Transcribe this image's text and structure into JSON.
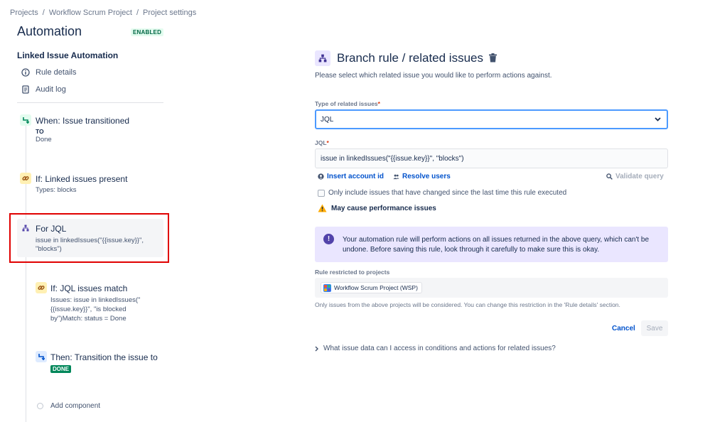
{
  "breadcrumb": {
    "items": [
      "Projects",
      "Workflow Scrum Project",
      "Project settings"
    ],
    "separator": "/"
  },
  "page": {
    "title": "Automation",
    "status_badge": "ENABLED"
  },
  "sidebar": {
    "rule_name": "Linked Issue Automation",
    "links": [
      {
        "label": "Rule details",
        "icon": "info-icon"
      },
      {
        "label": "Audit log",
        "icon": "document-icon"
      }
    ],
    "components": [
      {
        "title": "When: Issue transitioned",
        "lines": [
          "TO",
          "Done"
        ],
        "icon": "transition-icon",
        "color": "#e3fcef"
      },
      {
        "title": "If: Linked issues present",
        "lines": [
          "Types: blocks"
        ],
        "icon": "link-icon",
        "color": "#fff0b3"
      },
      {
        "title": "For JQL",
        "lines": [
          "issue in linkedIssues(\"{{issue.key}}\",",
          "\"blocks\")"
        ],
        "icon": "branch-icon",
        "color": "#eae6ff"
      },
      {
        "title": "If: JQL issues match",
        "lines": [
          "Issues: issue in linkedIssues(\"",
          "{{issue.key}}\", \"is blocked",
          "by\")Match: status = Done"
        ],
        "icon": "link-icon",
        "color": "#fff0b3"
      },
      {
        "title": "Then: Transition the issue to",
        "lozenge": "DONE",
        "icon": "transition-icon",
        "color": "#deebff"
      }
    ],
    "add_component": "Add component"
  },
  "main": {
    "title": "Branch rule / related issues",
    "description": "Please select which related issue you would like to perform actions against.",
    "type_label": "Type of related issues",
    "type_value": "JQL",
    "jql_label": "JQL",
    "jql_value": "issue in linkedIssues(\"{{issue.key}}\", \"blocks\")",
    "insert_account_id": "Insert account id",
    "resolve_users": "Resolve users",
    "validate_query": "Validate query",
    "checkbox_label": "Only include issues that have changed since the last time this rule executed",
    "warning": "May cause performance issues",
    "info_text": "Your automation rule will perform actions on all issues returned in the above query, which can't be undone. Before saving this rule, look through it carefully to make sure this is okay.",
    "restricted_label": "Rule restricted to projects",
    "project_tag": "Workflow Scrum Project (WSP)",
    "restriction_help": "Only issues from the above projects will be considered. You can change this restriction in the 'Rule details' section.",
    "cancel_label": "Cancel",
    "save_label": "Save",
    "expander_label": "What issue data can I access in conditions and actions for related issues?"
  },
  "colors": {
    "accent": "#0052cc",
    "success": "#00875a",
    "highlight": "#e00000",
    "info_panel": "#eae6ff"
  }
}
